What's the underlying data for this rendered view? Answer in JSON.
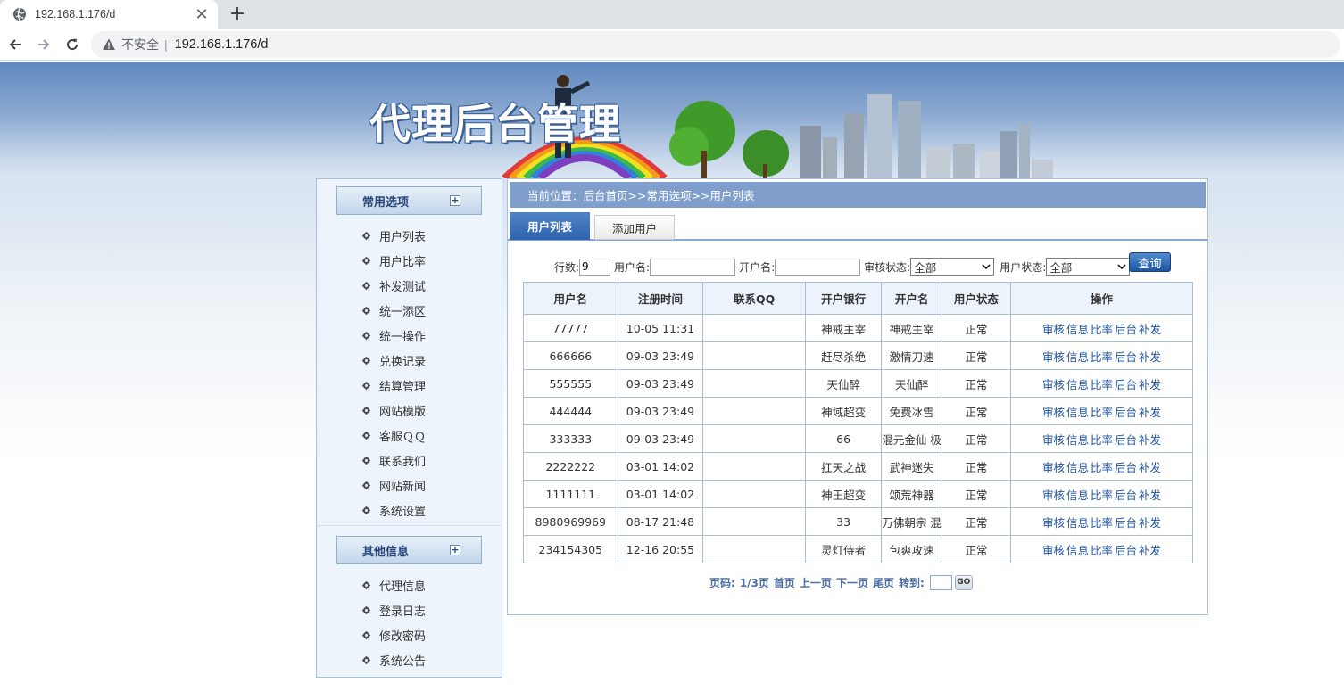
{
  "browser": {
    "tab_title": "192.168.1.176/d",
    "security_label": "不安全",
    "separator": "|",
    "url": "192.168.1.176/d"
  },
  "banner": {
    "title": "代理后台管理"
  },
  "sidebar": {
    "group1": {
      "title": "常用选项",
      "items": [
        "用户列表",
        "用户比率",
        "补发测试",
        "统一添区",
        "统一操作",
        "兑换记录",
        "结算管理",
        "网站模版",
        "客服ＱＱ",
        "联系我们",
        "网站新闻",
        "系统设置"
      ]
    },
    "group2": {
      "title": "其他信息",
      "items": [
        "代理信息",
        "登录日志",
        "修改密码",
        "系统公告"
      ]
    }
  },
  "main": {
    "breadcrumb": "当前位置：后台首页>>常用选项>>用户列表",
    "tabs": [
      {
        "label": "用户列表",
        "active": true
      },
      {
        "label": "添加用户",
        "active": false
      }
    ],
    "filters": {
      "rows_label": "行数:",
      "rows_value": "9",
      "username_label": "用户名:",
      "username_value": "",
      "account_name_label": "开户名:",
      "account_name_value": "",
      "audit_label": "审核状态:",
      "audit_value": "全部",
      "status_label": "用户状态:",
      "status_value": "全部",
      "query_button": "查询"
    },
    "table": {
      "columns": [
        "用户名",
        "注册时间",
        "联系QQ",
        "开户银行",
        "开户名",
        "用户状态",
        "操作"
      ],
      "rows": [
        {
          "username": "77777",
          "reg_time": "10-05 11:31",
          "qq": "",
          "bank": "神戒主宰",
          "account_name": "神戒主宰",
          "status": "正常"
        },
        {
          "username": "666666",
          "reg_time": "09-03 23:49",
          "qq": "",
          "bank": "赶尽杀绝",
          "account_name": "激情刀速",
          "status": "正常"
        },
        {
          "username": "555555",
          "reg_time": "09-03 23:49",
          "qq": "",
          "bank": "天仙醉",
          "account_name": "天仙醉",
          "status": "正常"
        },
        {
          "username": "444444",
          "reg_time": "09-03 23:49",
          "qq": "",
          "bank": "神域超变",
          "account_name": "免费冰雪",
          "status": "正常"
        },
        {
          "username": "333333",
          "reg_time": "09-03 23:49",
          "qq": "",
          "bank": "66",
          "account_name": "混元金仙 极",
          "status": "正常"
        },
        {
          "username": "2222222",
          "reg_time": "03-01 14:02",
          "qq": "",
          "bank": "扛天之战",
          "account_name": "武神迷失",
          "status": "正常"
        },
        {
          "username": "1111111",
          "reg_time": "03-01 14:02",
          "qq": "",
          "bank": "神王超变",
          "account_name": "颂荒神器",
          "status": "正常"
        },
        {
          "username": "8980969969",
          "reg_time": "08-17 21:48",
          "qq": "",
          "bank": "33",
          "account_name": "万佛朝宗 混",
          "status": "正常"
        },
        {
          "username": "234154305",
          "reg_time": "12-16 20:55",
          "qq": "",
          "bank": "灵灯侍者",
          "account_name": "包爽攻速",
          "status": "正常"
        }
      ],
      "actions": [
        "审核",
        "信息",
        "比率",
        "后台",
        "补发"
      ]
    },
    "pager": {
      "label": "页码:",
      "page_info": "1/3页",
      "first": "首页",
      "prev": "上一页",
      "next": "下一页",
      "last": "尾页",
      "goto_label": "转到:",
      "go_button": "GO"
    }
  }
}
